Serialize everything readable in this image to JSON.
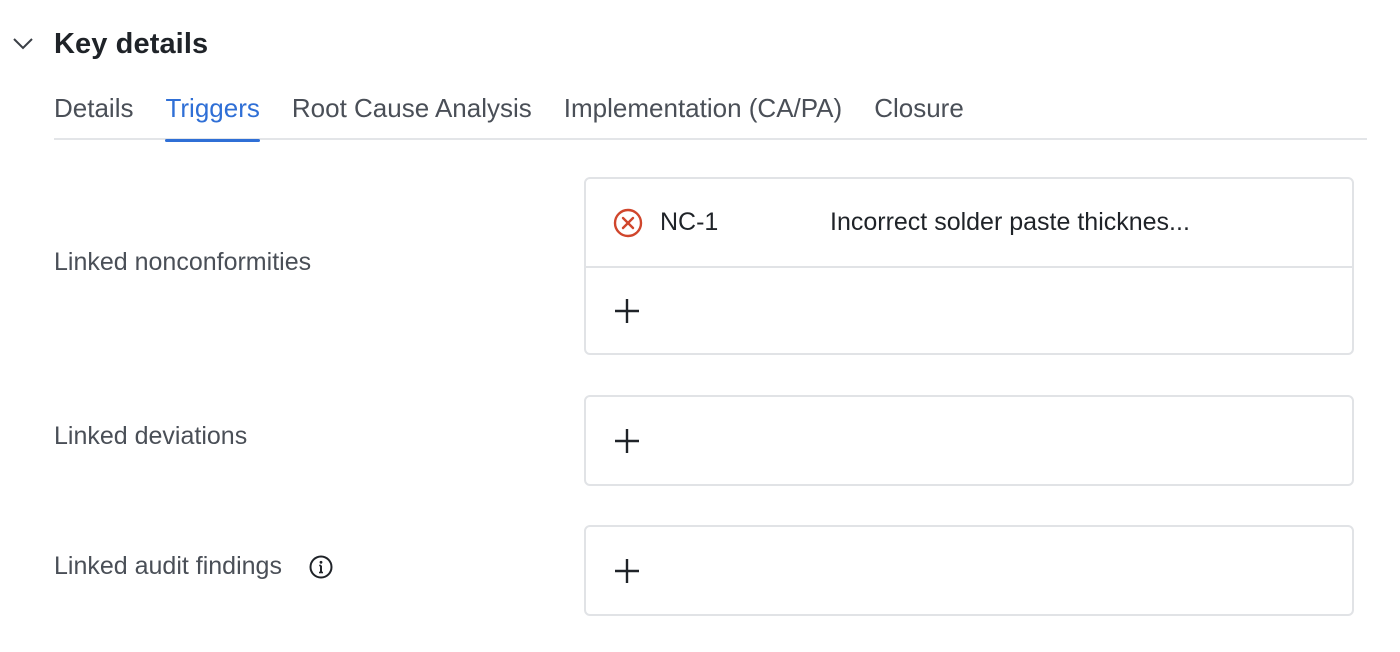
{
  "section": {
    "title": "Key details",
    "toggle_icon": "chevron-down-icon"
  },
  "tabs": [
    {
      "label": "Details",
      "active": false
    },
    {
      "label": "Triggers",
      "active": true
    },
    {
      "label": "Root Cause Analysis",
      "active": false
    },
    {
      "label": "Implementation (CA/PA)",
      "active": false
    },
    {
      "label": "Closure",
      "active": false
    }
  ],
  "fields": {
    "nonconformities": {
      "label": "Linked nonconformities",
      "items": [
        {
          "id": "NC-1",
          "title": "Incorrect solder paste thicknes..."
        }
      ]
    },
    "deviations": {
      "label": "Linked deviations",
      "items": []
    },
    "audit_findings": {
      "label": "Linked audit findings",
      "info_icon": "info-icon",
      "items": []
    }
  },
  "colors": {
    "accent": "#2f6fd6",
    "remove": "#d0462c",
    "border": "#e1e3e6",
    "label": "#4a4f57"
  }
}
